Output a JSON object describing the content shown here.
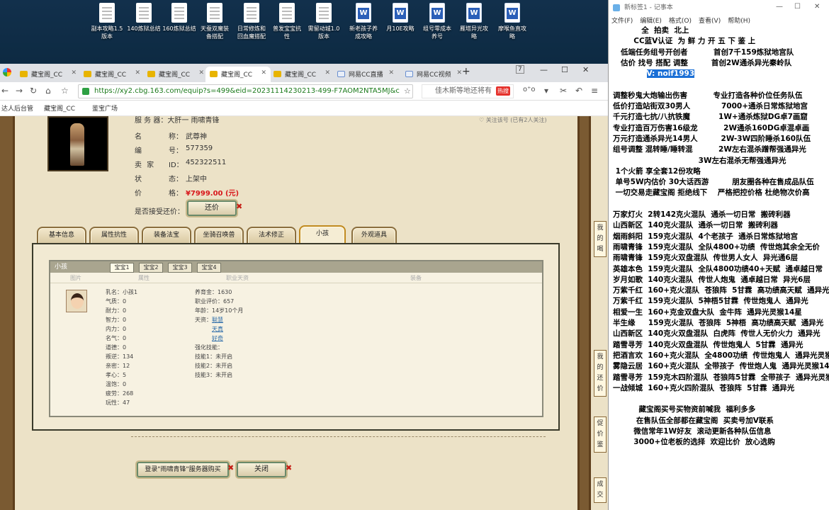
{
  "desktop": {
    "icons": [
      {
        "label": "副本攻略1.5\n版本",
        "kind": "doc"
      },
      {
        "label": "140炼狱总结",
        "kind": "doc"
      },
      {
        "label": "160炼狱总结",
        "kind": "doc"
      },
      {
        "label": "天蚕双魔装\n备搭配",
        "kind": "doc"
      },
      {
        "label": "日常修炼和\n回血魔搭配",
        "kind": "doc"
      },
      {
        "label": "普发宝宝抗\n性",
        "kind": "doc"
      },
      {
        "label": "需留动城1.0\n版本",
        "kind": "doc"
      },
      {
        "label": "新老孩子养\n成攻略",
        "kind": "word"
      },
      {
        "label": "月10E攻略",
        "kind": "word"
      },
      {
        "label": "组号零成本\n养号",
        "kind": "word"
      },
      {
        "label": "雁塔异光攻\n略",
        "kind": "word"
      },
      {
        "label": "摩喉鱼直攻\n略",
        "kind": "word"
      }
    ]
  },
  "browser": {
    "tabs": [
      "藏宝阁_CC",
      "藏宝阁_CC",
      "藏宝阁_CC",
      "藏宝阁_CC",
      "藏宝阁_CC",
      "网易CC直播",
      "网易CC视频"
    ],
    "new_tab": "+",
    "url": "https://xy2.cbg.163.com/equip?s=499&eid=20231114230213-499-F7AOM2NTA5MJ&c",
    "search_placeholder": "佳木斯等地还将有",
    "search_badge": "热搜",
    "bookmarks": [
      "达人后台管",
      "藏宝阁_CC",
      "鉴宝广场"
    ],
    "window_btns": [
      "—",
      "☐",
      "✕"
    ]
  },
  "game": {
    "server_label": "服 务 器：大肝一 雨啸青锋",
    "top_note": "♡ 关注该号 (已有2人关注)",
    "fields": [
      {
        "k": "名",
        "k2": "称：",
        "v": "武尊神"
      },
      {
        "k": "编",
        "k2": "号：",
        "v": "577359"
      },
      {
        "k": "卖 家",
        "k2": "ID：",
        "v": "452322511"
      },
      {
        "k": "状",
        "k2": "态：",
        "v": "上架中"
      },
      {
        "k": "价",
        "k2": "格：",
        "v": "¥7999.00 (元)"
      }
    ],
    "bargain_label": "是否接受还价：",
    "bargain_button": "还价",
    "tabs": [
      "基本信息",
      "属性抗性",
      "装备法宝",
      "坐骑召唤兽",
      "法术修正",
      "小孩",
      "外观道具"
    ],
    "child_panel": {
      "title": "小孩",
      "subtabs": [
        "宝宝1",
        "宝宝2",
        "宝宝3",
        "宝宝4"
      ],
      "headers": [
        "图片",
        "属性",
        "职业天资",
        "装备"
      ],
      "left_stats": [
        "乳名：小孩1",
        "气质：0",
        "耐力：0",
        "智力：0",
        "内力：0",
        "名气：0",
        "道德：0",
        "叛逆：134",
        "亲密：12",
        "孝心：5",
        "温饱：0",
        "疲劳：268",
        "玩性：47"
      ],
      "right_stats": [
        "养育金：1630",
        "职业评价：657",
        "年龄：14岁10个月",
        "天资："
      ],
      "talents": [
        "聪慧",
        "天真",
        "好奇"
      ],
      "skills_title": "强化技能：",
      "skills": [
        "技能1：未开启",
        "技能2：未开启",
        "技能3：未开启"
      ]
    },
    "login_button": "登录\"雨啸青锋\"服务器购买",
    "close_button": "关闭",
    "right_chars": [
      "我",
      "的",
      "喝",
      "我",
      "的",
      "还",
      "价",
      "促",
      "价",
      "鉴",
      "成",
      "交"
    ]
  },
  "notepad": {
    "title": "新标签1 - 记事本",
    "menu": [
      "文件(F)",
      "编辑(E)",
      "格式(O)",
      "查看(V)",
      "帮助(H)"
    ],
    "controls": [
      "—",
      "☐",
      "✕"
    ],
    "lines": [
      "           全  拍卖  北上",
      "        CC蓝V认证  为 鲜 力 开 五 下 鉴 上",
      "   低端任务组号开创者          首创7千159炼狱地宫队",
      "   估价 找号 搭配 调整         首创2W通杀异光秦岭队",
      "",
      "",
      "调整秒鬼大炮输出伤害          专业打造各种价位任务队伍",
      "低价打造站街双30男人            7000+通杀日常炼狱地宫",
      "千元打造七抗/八抗铁魔           1W+通杀炼狱DG卓7画窟",
      "专业打造百万伤害16级龙          2W通杀160DG卓混卓画",
      "万元打造通杀异光14男人         2W-3W四阶睡杀160队伍",
      "组号调整 混转睡/睡转混          2W左右混杀蹭帮强通异光",
      "                                 3W左右混杀无帮强通异光",
      " 1个火箭 享全套12份攻略",
      " 单号5W内估价 30大话西游         朋友圈各种在售成品队伍",
      " 一切交易走藏宝阁 拒绝线下    严格把控价格 杜绝物次价高",
      "",
      "万家灯火  2转142克火混队  通杀一切日常  搬砖利器",
      "山西新区  140克火混队  通杀一切日常  搬砖利器",
      "烟雨斜阳  159克火混队  4个老孩子  通杀日常炼狱地宫",
      "雨啸青锋  159克火混队  全队4800+功绩  传世炮其余全无价",
      "雨啸青锋  159克火双盘混队  传世男人女人  异光通6层",
      "英雄本色  159克火混队  全队4800功绩40+天赋  通卓越日常",
      "岁月如歌  140克火混队  传世人炮鬼  通卓越日常  异光6层",
      "万紫千红  160+克火混队  苍狼阵  5甘霖  高功绩高天赋  通异光",
      "万紫千红  159克火混队  5神梧5甘霖  传世炮鬼人  通异光",
      "相爱一生  160+克金双盘大队  金牛阵  通异光灵猴14星",
      "半生缘     159克火混队  苍狼阵  5神梧  高功绩高天赋  通异光",
      "山西新区  140克火双盘混队  白虎阵  传世人无价火力  通异光",
      "踏雪寻芳  140克火双盘混队  传世炮鬼人  5甘霖  通异光",
      "把酒言欢  160+克火混队  全4800功绩  传世炮鬼人  通异光灵猴",
      "雾隐云居  160+克火混队  全带孩子  传世炮人鬼  通异光灵猴14",
      "踏雪寻芳  159克木四阶混队  苍狼阵5甘霖  全带孩子  通异光灵猴",
      "一战倾城  160+克火四阶混队  苍狼阵  5甘霖  通异光",
      "",
      "          藏宝阁买号买物资前喊我  福利多多",
      "         在售队伍全部都在藏宝阁  买卖号加V联系",
      "        微信常年1W好友  滚动更新各种队伍信息",
      "        3000+位老板的选择  欢迎比价  放心选购"
    ],
    "highlight": "V: noif1993"
  }
}
